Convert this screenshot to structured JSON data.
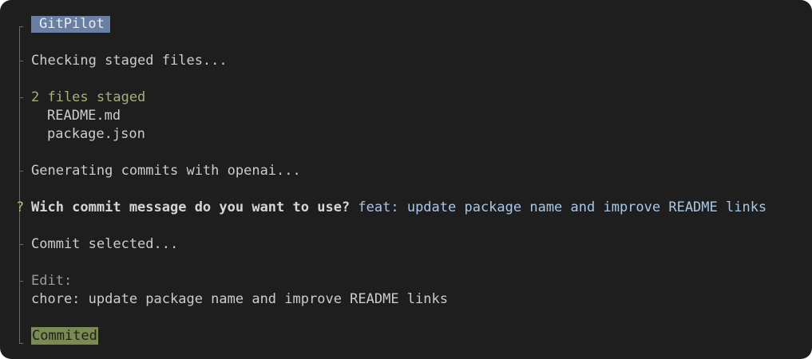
{
  "app": {
    "title": "GitPilot"
  },
  "log": {
    "checking": "Checking staged files...",
    "staged_count": "2 files staged",
    "files": [
      "README.md",
      "package.json"
    ],
    "generating": "Generating commits with openai...",
    "prompt_marker": "?",
    "question": "Wich commit message do you want to use?",
    "answer": "feat: update package name and improve README links",
    "selected": "Commit selected...",
    "edit_label": "Edit:",
    "edit_value": "chore: update package name and improve README links",
    "done": "Commited"
  },
  "colors": {
    "background": "#1e1e1e",
    "title_badge": "#6a7fa4",
    "success_text": "#a6b07a",
    "done_badge": "#7a8a52",
    "answer_text": "#a8c8e8",
    "prompt_marker": "#c8b86a"
  }
}
